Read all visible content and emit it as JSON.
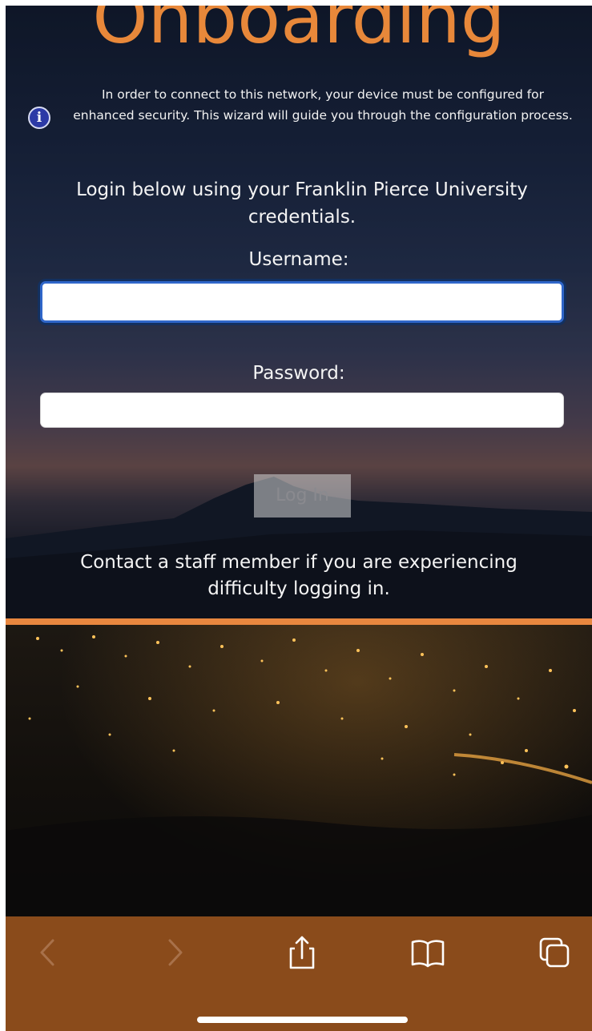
{
  "page": {
    "title": "Onboarding",
    "info_text": "In order to connect to this network, your device must be configured for enhanced security. This wizard will guide you through the configuration process.",
    "login_prompt": "Login below using your Franklin Pierce University credentials.",
    "username_label": "Username:",
    "username_value": "",
    "password_label": "Password:",
    "password_value": "",
    "login_button": "Log In",
    "help_text": "Contact a staff member if you are experiencing difficulty logging in."
  },
  "toolbar": {
    "items": [
      "back-icon",
      "forward-icon",
      "share-icon",
      "bookmarks-icon",
      "tabs-icon"
    ]
  },
  "colors": {
    "accent": "#e8873f",
    "toolbar": "#8a4b1b",
    "focus_ring": "#2f66c9",
    "info_icon": "#2c3aa6"
  }
}
